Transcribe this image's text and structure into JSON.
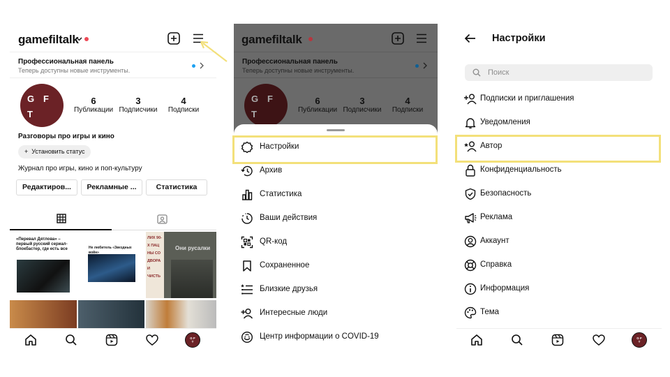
{
  "profile": {
    "username": "gamefiltalk",
    "pro_panel": {
      "title": "Профессиональная панель",
      "subtitle": "Теперь доступны новые инструменты."
    },
    "avatar_letters": [
      "G",
      "F",
      "T"
    ],
    "stats": [
      {
        "value": "6",
        "label": "Публикации"
      },
      {
        "value": "3",
        "label": "Подписчики"
      },
      {
        "value": "4",
        "label": "Подписки"
      }
    ],
    "bio_name": "Разговоры про игры и кино",
    "status_button": "Установить статус",
    "bio": "Журнал про игры, кино и поп-культуру",
    "buttons": [
      "Редактиров...",
      "Рекламные ...",
      "Статистика"
    ],
    "posts": [
      {
        "text": "«Перевал Дятлова» – первый русский сериал-блокбастер, где есть все"
      },
      {
        "text": "Не любитель «Звездных войн»"
      },
      {
        "text": "ЛИХ 90-Х ПАЦ НЫ СО ДВОРА И ЧИСТЬ"
      },
      {
        "text": "Они русалки"
      }
    ]
  },
  "menu": {
    "items": [
      {
        "label": "Настройки",
        "icon": "settings-gear-icon"
      },
      {
        "label": "Архив",
        "icon": "archive-clock-icon"
      },
      {
        "label": "Статистика",
        "icon": "insights-bars-icon"
      },
      {
        "label": "Ваши действия",
        "icon": "activity-icon"
      },
      {
        "label": "QR-код",
        "icon": "qr-code-icon"
      },
      {
        "label": "Сохраненное",
        "icon": "bookmark-icon"
      },
      {
        "label": "Близкие друзья",
        "icon": "close-friends-list-icon"
      },
      {
        "label": "Интересные люди",
        "icon": "discover-people-icon"
      },
      {
        "label": "Центр информации о COVID-19",
        "icon": "covid-info-icon"
      }
    ]
  },
  "settings": {
    "title": "Настройки",
    "search_placeholder": "Поиск",
    "items": [
      {
        "label": "Подписки и приглашения",
        "icon": "follow-invite-icon"
      },
      {
        "label": "Уведомления",
        "icon": "bell-icon"
      },
      {
        "label": "Автор",
        "icon": "creator-icon"
      },
      {
        "label": "Конфиденциальность",
        "icon": "lock-icon"
      },
      {
        "label": "Безопасность",
        "icon": "shield-icon"
      },
      {
        "label": "Реклама",
        "icon": "megaphone-icon"
      },
      {
        "label": "Аккаунт",
        "icon": "account-icon"
      },
      {
        "label": "Справка",
        "icon": "lifebuoy-icon"
      },
      {
        "label": "Информация",
        "icon": "info-icon"
      },
      {
        "label": "Тема",
        "icon": "palette-icon"
      }
    ]
  },
  "highlight_color": "#f3e07a"
}
